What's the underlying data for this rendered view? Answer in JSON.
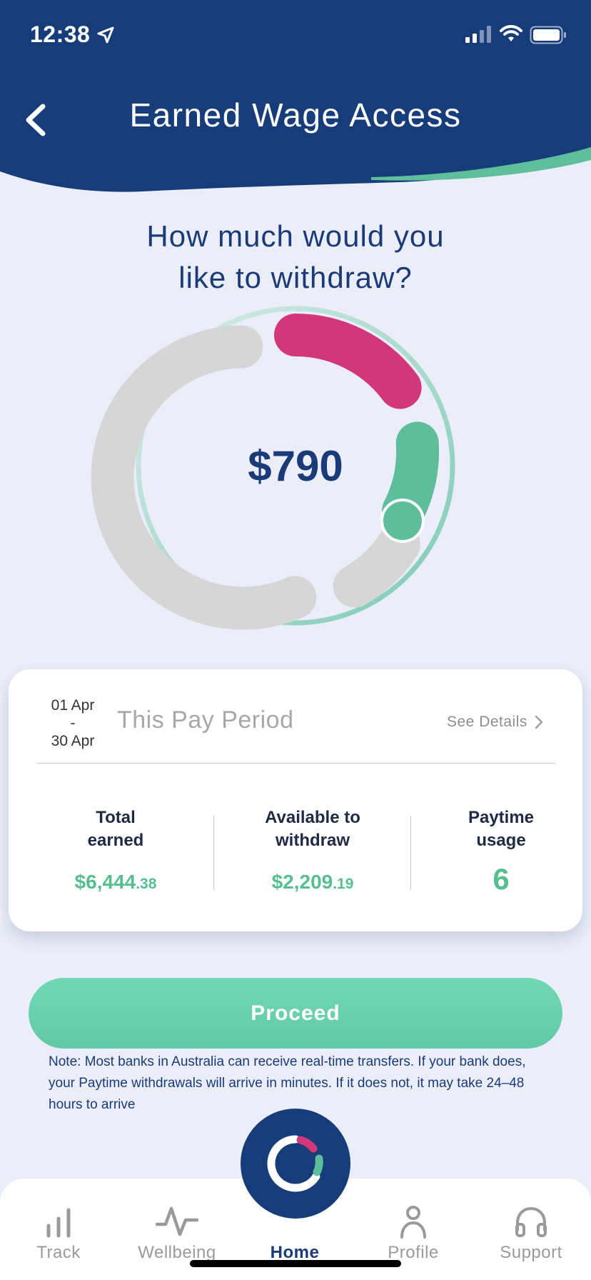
{
  "status_bar": {
    "time": "12:38"
  },
  "header": {
    "title": "Earned Wage Access",
    "background_color": "#173c7a",
    "accent_color": "#5fbf9c"
  },
  "question": {
    "line1": "How much would you",
    "line2": "like to withdraw?"
  },
  "gauge": {
    "amount": "$790",
    "colors": {
      "track": "#d6d6d6",
      "pink": "#d1377a",
      "green": "#5ebe9c"
    }
  },
  "pay_period": {
    "start": "01 Apr",
    "separator": "-",
    "end": "30 Apr",
    "label": "This Pay Period",
    "details_link": "See Details"
  },
  "stats": [
    {
      "label_line1": "Total",
      "label_line2": "earned",
      "value_main": "$6,444",
      "value_cents": ".38"
    },
    {
      "label_line1": "Available to",
      "label_line2": "withdraw",
      "value_main": "$2,209",
      "value_cents": ".19"
    },
    {
      "label_line1": "Paytime",
      "label_line2": "usage",
      "value_main": "6",
      "value_cents": ""
    }
  ],
  "proceed": {
    "label": "Proceed"
  },
  "note": "Note: Most banks in Australia can receive real-time transfers. If your bank does, your Paytime withdrawals will arrive in minutes. If it does not, it may take 24–48 hours to arrive",
  "tab_bar": {
    "items": [
      {
        "label": "Track",
        "icon": "bar-chart-icon"
      },
      {
        "label": "Wellbeing",
        "icon": "pulse-icon"
      },
      {
        "label": "Home",
        "icon": "home-logo-icon",
        "active": true
      },
      {
        "label": "Profile",
        "icon": "person-icon"
      },
      {
        "label": "Support",
        "icon": "headphones-icon"
      }
    ]
  }
}
